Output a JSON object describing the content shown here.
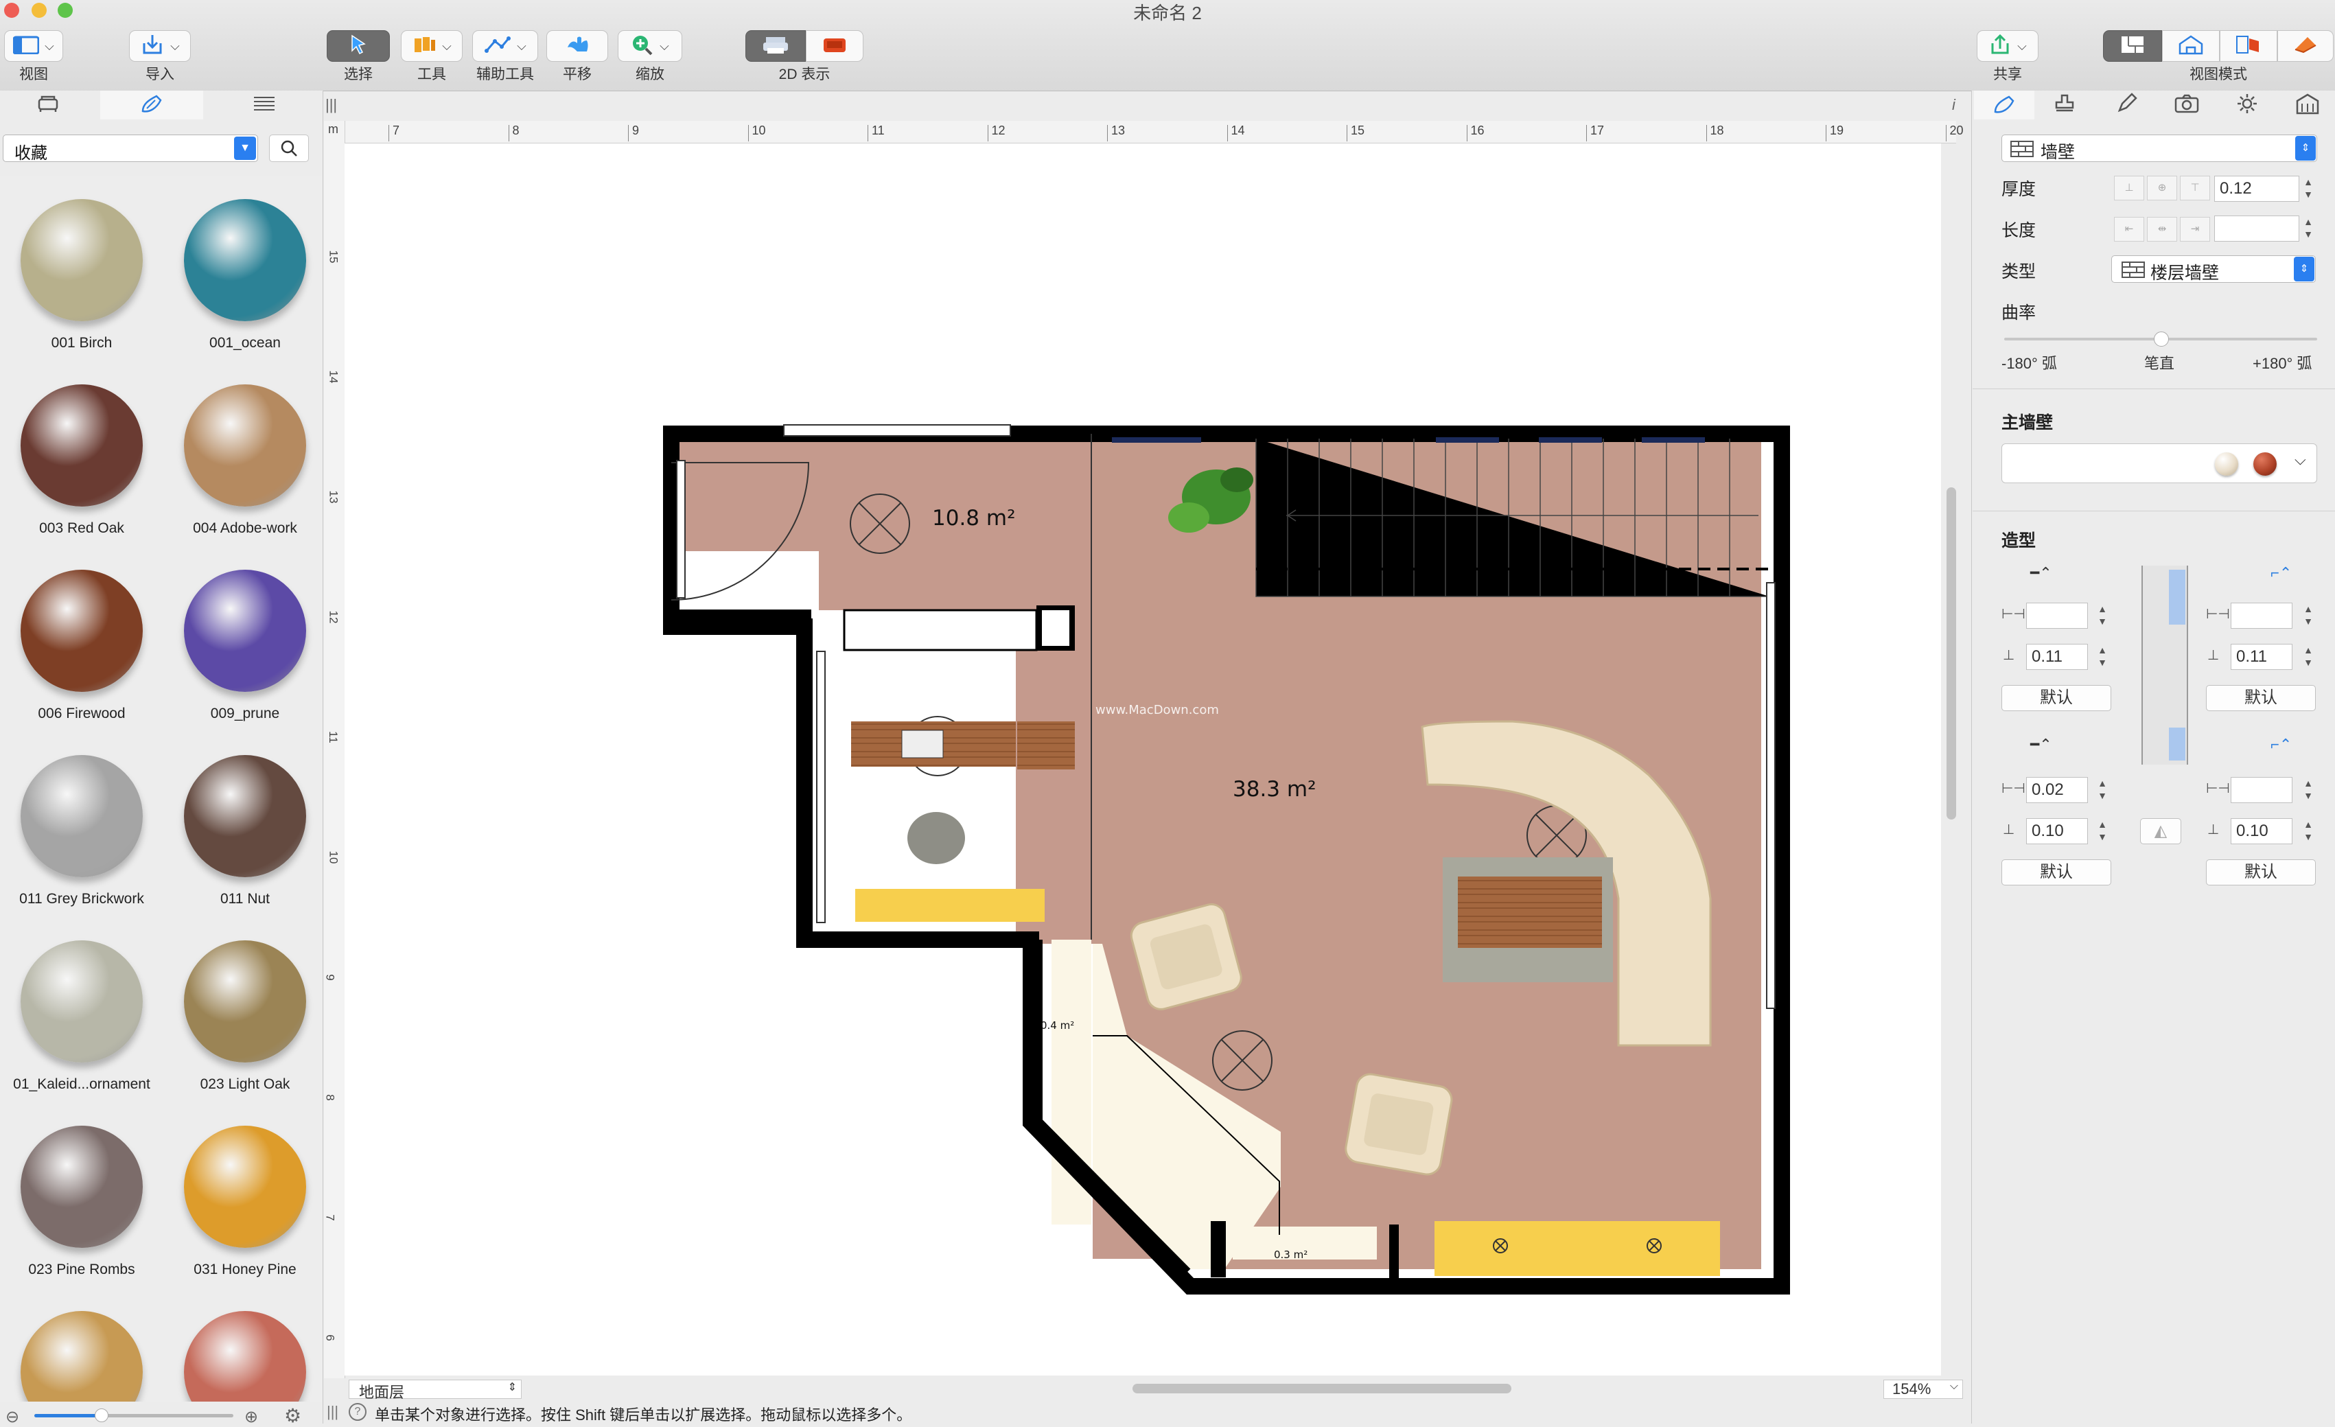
{
  "window": {
    "title": "未命名 2"
  },
  "toolbar": {
    "view": "视图",
    "import": "导入",
    "select": "选择",
    "tools": "工具",
    "aux_tools": "辅助工具",
    "pan": "平移",
    "zoom": "缩放",
    "display_2d": "2D 表示",
    "share": "共享",
    "view_mode": "视图模式"
  },
  "left_panel": {
    "collection": "收藏",
    "materials": [
      {
        "name": "001 Birch",
        "color": "#b7b08c"
      },
      {
        "name": "001_ocean",
        "color": "#2c8296"
      },
      {
        "name": "003 Red Oak",
        "color": "#6a3b32"
      },
      {
        "name": "004 Adobe-work",
        "color": "#b58a60"
      },
      {
        "name": "006 Firewood",
        "color": "#7e3f25"
      },
      {
        "name": "009_prune",
        "color": "#5c4aa6"
      },
      {
        "name": "011 Grey Brickwork",
        "color": "#a5a5a5"
      },
      {
        "name": "011 Nut",
        "color": "#644a40"
      },
      {
        "name": "01_Kaleid...ornament",
        "color": "#b7b7a8"
      },
      {
        "name": "023 Light Oak",
        "color": "#9b8455"
      },
      {
        "name": "023 Pine Rombs",
        "color": "#7c6c6a"
      },
      {
        "name": "031 Honey Pine",
        "color": "#dd9c2b"
      },
      {
        "name": "",
        "color": "#c79a53"
      },
      {
        "name": "",
        "color": "#c56a5a"
      }
    ]
  },
  "canvas": {
    "ruler_unit": "m",
    "ruler_top": [
      "7",
      "8",
      "9",
      "10",
      "11",
      "12",
      "13",
      "14",
      "15",
      "16",
      "17",
      "18",
      "19",
      "20"
    ],
    "ruler_left": [
      "15",
      "14",
      "13",
      "12",
      "11",
      "10",
      "9",
      "8",
      "7",
      "6"
    ],
    "rooms": {
      "area_small": "10.8 m²",
      "area_large": "38.3 m²",
      "area_tiny1": "0.4 m²",
      "area_tiny2": "0.3 m²"
    },
    "watermark": "www.MacDown.com",
    "floor": "地面层",
    "zoom": "154%"
  },
  "status": {
    "text": "单击某个对象进行选择。按住 Shift 键后单击以扩展选择。拖动鼠标以选择多个。"
  },
  "right_panel": {
    "object_type": "墙壁",
    "thickness_label": "厚度",
    "thickness": "0.12",
    "length_label": "长度",
    "length": "",
    "type_label": "类型",
    "type_value": "楼层墙壁",
    "curvature_label": "曲率",
    "curv_left": "-180° 弧",
    "curv_mid": "笔直",
    "curv_right": "+180° 弧",
    "curvature_value": 0.5,
    "main_wall": "主墙壁",
    "shape": "造型",
    "left_width": "",
    "left_height": "0.11",
    "right_width": "",
    "right_height": "0.11",
    "default_label": "默认",
    "left_width2": "0.02",
    "left_height2": "0.10",
    "right_width2": "",
    "right_height2": "0.10",
    "swatch_colors": [
      "#e8dcc8",
      "#b04328"
    ]
  }
}
